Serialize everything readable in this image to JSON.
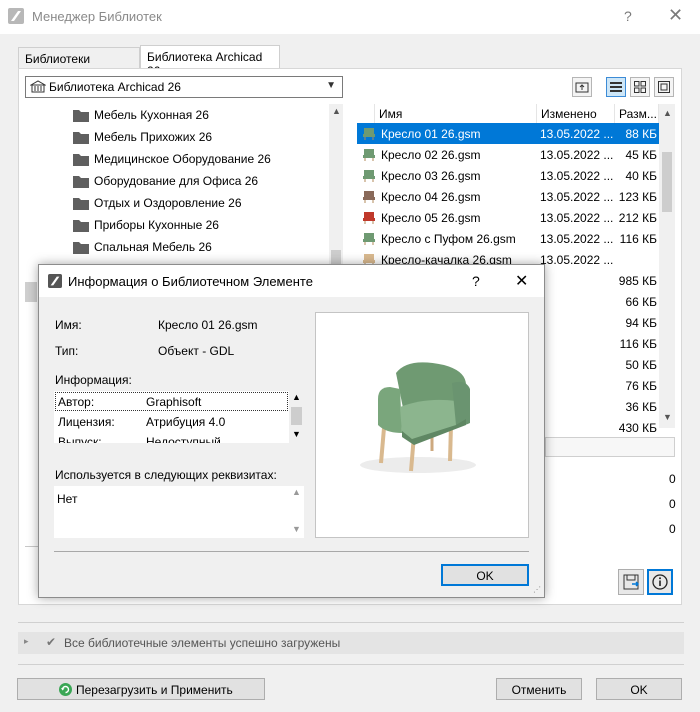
{
  "window": {
    "title": "Менеджер Библиотек",
    "help": "?",
    "close": "✕"
  },
  "tabs": [
    {
      "label": "Библиотеки Проекта"
    },
    {
      "label": "Библиотека Archicad 26"
    }
  ],
  "library_select": {
    "value": "Библиотека Archicad 26"
  },
  "tree": {
    "items": [
      "Мебель Кухонная 26",
      "Мебель Прихожих 26",
      "Медицинское Оборудование 26",
      "Оборудование для Офиса 26",
      "Отдых и Оздоровление 26",
      "Приборы Кухонные 26",
      "Спальная Мебель 26"
    ]
  },
  "files": {
    "columns": [
      "Имя",
      "Изменено",
      "Разм..."
    ],
    "rows": [
      {
        "name": "Кресло 01 26.gsm",
        "date": "13.05.2022 ...",
        "size": "88 КБ",
        "selected": true
      },
      {
        "name": "Кресло 02 26.gsm",
        "date": "13.05.2022 ...",
        "size": "45 КБ"
      },
      {
        "name": "Кресло 03 26.gsm",
        "date": "13.05.2022 ...",
        "size": "40 КБ"
      },
      {
        "name": "Кресло 04 26.gsm",
        "date": "13.05.2022 ...",
        "size": "123 КБ"
      },
      {
        "name": "Кресло 05 26.gsm",
        "date": "13.05.2022 ...",
        "size": "212 КБ"
      },
      {
        "name": "Кресло с Пуфом 26.gsm",
        "date": "13.05.2022 ...",
        "size": "116 КБ"
      },
      {
        "name": "Кресло-качалка 26.gsm",
        "date": "13.05.2022 ...",
        "size": ""
      }
    ],
    "hidden_sizes": [
      "985 КБ",
      "66 КБ",
      "94 КБ",
      "116 КБ",
      "50 КБ",
      "76 КБ",
      "36 КБ",
      "430 КБ"
    ]
  },
  "right_counts": [
    "0",
    "0",
    "0"
  ],
  "info_dialog": {
    "title": "Информация о Библиотечном Элементе",
    "help": "?",
    "close": "✕",
    "name_label": "Имя:",
    "name_value": "Кресло 01 26.gsm",
    "type_label": "Тип:",
    "type_value": "Объект - GDL",
    "info_label": "Информация:",
    "info_rows": [
      {
        "k": "Автор:",
        "v": "Graphisoft"
      },
      {
        "k": "Лицензия:",
        "v": "Атрибуция 4.0"
      },
      {
        "k": "Выпуск:",
        "v": "Недоступный"
      }
    ],
    "used_label": "Используется в следующих реквизитах:",
    "used_value": "Нет",
    "ok": "OK"
  },
  "status_text": "Все библиотечные элементы успешно загружены",
  "buttons": {
    "reload": "Перезагрузить и Применить",
    "cancel": "Отменить",
    "ok": "OK"
  }
}
